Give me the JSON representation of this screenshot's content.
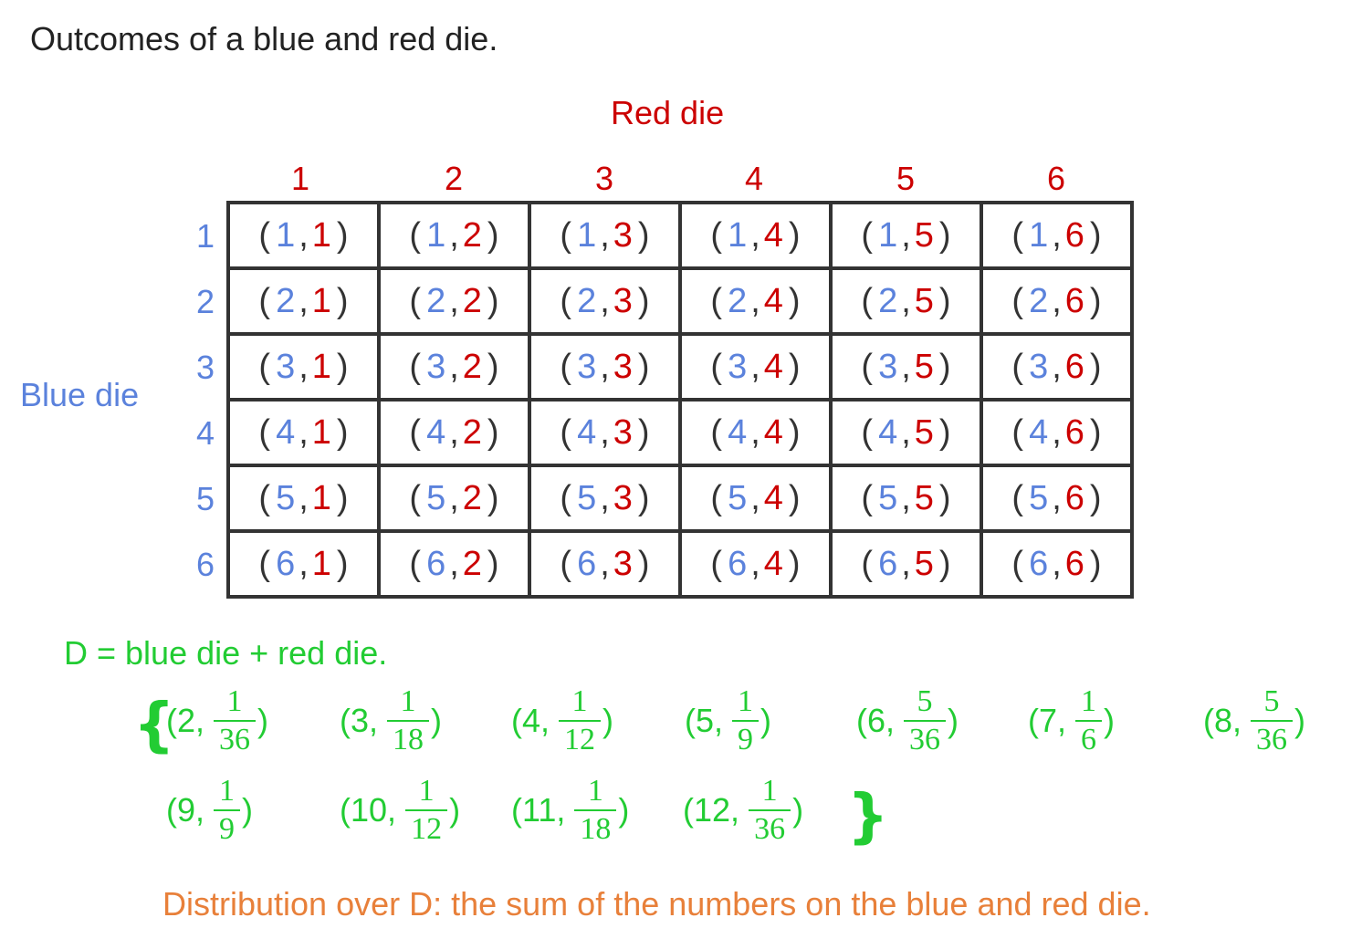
{
  "title": "Outcomes of a blue and red die.",
  "red_die_label": "Red die",
  "blue_die_label": "Blue die",
  "col_headers": [
    "1",
    "2",
    "3",
    "4",
    "5",
    "6"
  ],
  "row_headers": [
    "1",
    "2",
    "3",
    "4",
    "5",
    "6"
  ],
  "grid": [
    [
      [
        "1",
        "1"
      ],
      [
        "1",
        "2"
      ],
      [
        "1",
        "3"
      ],
      [
        "1",
        "4"
      ],
      [
        "1",
        "5"
      ],
      [
        "1",
        "6"
      ]
    ],
    [
      [
        "2",
        "1"
      ],
      [
        "2",
        "2"
      ],
      [
        "2",
        "3"
      ],
      [
        "2",
        "4"
      ],
      [
        "2",
        "5"
      ],
      [
        "2",
        "6"
      ]
    ],
    [
      [
        "3",
        "1"
      ],
      [
        "3",
        "2"
      ],
      [
        "3",
        "3"
      ],
      [
        "3",
        "4"
      ],
      [
        "3",
        "5"
      ],
      [
        "3",
        "6"
      ]
    ],
    [
      [
        "4",
        "1"
      ],
      [
        "4",
        "2"
      ],
      [
        "4",
        "3"
      ],
      [
        "4",
        "4"
      ],
      [
        "4",
        "5"
      ],
      [
        "4",
        "6"
      ]
    ],
    [
      [
        "5",
        "1"
      ],
      [
        "5",
        "2"
      ],
      [
        "5",
        "3"
      ],
      [
        "5",
        "4"
      ],
      [
        "5",
        "5"
      ],
      [
        "5",
        "6"
      ]
    ],
    [
      [
        "6",
        "1"
      ],
      [
        "6",
        "2"
      ],
      [
        "6",
        "3"
      ],
      [
        "6",
        "4"
      ],
      [
        "6",
        "5"
      ],
      [
        "6",
        "6"
      ]
    ]
  ],
  "definition": "D = blue die + red die.",
  "open_brace": "{",
  "close_brace": "}",
  "distribution": [
    {
      "value": "2",
      "num": "1",
      "den": "36"
    },
    {
      "value": "3",
      "num": "1",
      "den": "18"
    },
    {
      "value": "4",
      "num": "1",
      "den": "12"
    },
    {
      "value": "5",
      "num": "1",
      "den": "9"
    },
    {
      "value": "6",
      "num": "5",
      "den": "36"
    },
    {
      "value": "7",
      "num": "1",
      "den": "6"
    },
    {
      "value": "8",
      "num": "5",
      "den": "36"
    },
    {
      "value": "9",
      "num": "1",
      "den": "9"
    },
    {
      "value": "10",
      "num": "1",
      "den": "12"
    },
    {
      "value": "11",
      "num": "1",
      "den": "18"
    },
    {
      "value": "12",
      "num": "1",
      "den": "36"
    }
  ],
  "caption": "Distribution over D: the sum of the numbers on the blue and red die.",
  "colors": {
    "blue": "#5b82dc",
    "red": "#cc0000",
    "green": "#22cc33",
    "orange": "#e8803a",
    "text": "#222222",
    "grid_border": "#333333"
  }
}
